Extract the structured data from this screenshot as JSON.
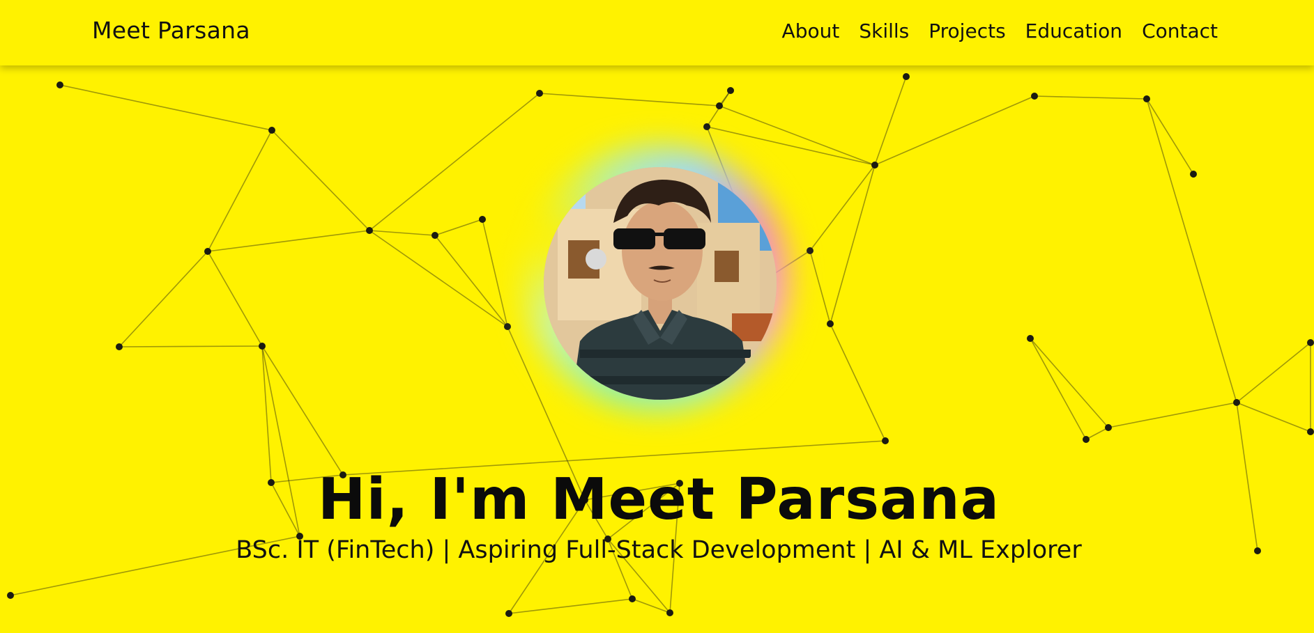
{
  "navbar": {
    "brand": "Meet Parsana",
    "links": [
      "About",
      "Skills",
      "Projects",
      "Education",
      "Contact"
    ]
  },
  "hero": {
    "title": "Hi, I'm Meet Parsana",
    "subtitle": "BSc. IT (FinTech) | Aspiring Full-Stack Development | AI & ML Explorer"
  },
  "colors": {
    "background": "#fff200",
    "text": "#111111"
  }
}
